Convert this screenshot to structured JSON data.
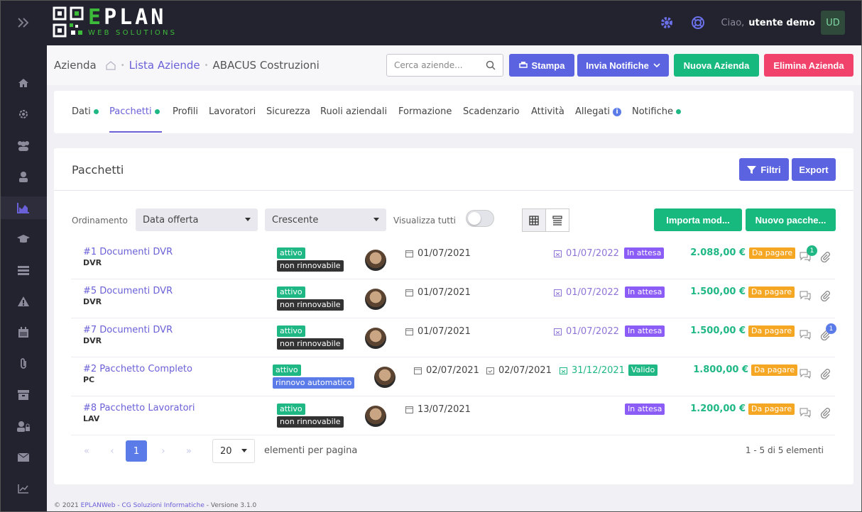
{
  "app": {
    "logo_main": "EPLAN",
    "logo_sub": "WEB SOLUTIONS",
    "greeting": "Ciao,",
    "user": "utente demo",
    "user_initials": "UD"
  },
  "sidebar": {
    "items": [
      "menu-toggle",
      "home",
      "settings",
      "users",
      "worker",
      "chart",
      "education",
      "storage",
      "warning",
      "calendar",
      "attachment",
      "archive",
      "user-lock",
      "mail",
      "reports"
    ]
  },
  "breadcrumb": {
    "section": "Azienda",
    "link": "Lista Aziende",
    "current": "ABACUS Costruzioni"
  },
  "search": {
    "placeholder": "Cerca aziende..."
  },
  "header_buttons": {
    "print": "Stampa",
    "notify": "Invia Notifiche",
    "new": "Nuova Azienda",
    "delete": "Elimina Azienda"
  },
  "tabs": [
    {
      "label": "Dati",
      "dot": true
    },
    {
      "label": "Pacchetti",
      "dot": true,
      "active": true
    },
    {
      "label": "Profili"
    },
    {
      "label": "Lavoratori"
    },
    {
      "label": "Sicurezza"
    },
    {
      "label": "Ruoli aziendali"
    },
    {
      "label": "Formazione"
    },
    {
      "label": "Scadenzario"
    },
    {
      "label": "Attività"
    },
    {
      "label": "Allegati",
      "info": true
    },
    {
      "label": "Notifiche",
      "dot": true
    }
  ],
  "card": {
    "title": "Pacchetti",
    "filter": "Filtri",
    "export": "Export"
  },
  "controls": {
    "order_label": "Ordinamento",
    "order_field": "Data offerta",
    "order_dir": "Crescente",
    "show_all": "Visualizza tutti",
    "import": "Importa mod...",
    "new_package": "Nuovo pacche..."
  },
  "rows": [
    {
      "title": "#1 Documenti DVR",
      "code": "DVR",
      "status": "attivo",
      "renewal": "non rinnovabile",
      "date1": "01/07/2021",
      "date2": "",
      "date3": "01/07/2022",
      "state": "In attesa",
      "price": "2.088,00 €",
      "payment": "Da pagare",
      "chat_count": "1",
      "clip_count": ""
    },
    {
      "title": "#5 Documenti DVR",
      "code": "DVR",
      "status": "attivo",
      "renewal": "non rinnovabile",
      "date1": "01/07/2021",
      "date2": "",
      "date3": "01/07/2022",
      "state": "In attesa",
      "price": "1.500,00 €",
      "payment": "Da pagare",
      "chat_count": "",
      "clip_count": ""
    },
    {
      "title": "#7 Documenti DVR",
      "code": "DVR",
      "status": "attivo",
      "renewal": "non rinnovabile",
      "date1": "01/07/2021",
      "date2": "",
      "date3": "01/07/2022",
      "state": "In attesa",
      "price": "1.500,00 €",
      "payment": "Da pagare",
      "chat_count": "",
      "clip_count": "1"
    },
    {
      "title": "#2 Pacchetto Completo",
      "code": "PC",
      "status": "attivo",
      "renewal": "rinnovo automatico",
      "date1": "02/07/2021",
      "date2": "02/07/2021",
      "date3": "31/12/2021",
      "state": "Valido",
      "price": "1.800,00 €",
      "payment": "Da pagare",
      "chat_count": "",
      "clip_count": ""
    },
    {
      "title": "#8 Pacchetto Lavoratori",
      "code": "LAV",
      "status": "attivo",
      "renewal": "non rinnovabile",
      "date1": "13/07/2021",
      "date2": "",
      "date3": "",
      "state": "In attesa",
      "price": "1.200,00 €",
      "payment": "Da pagare",
      "chat_count": "",
      "clip_count": ""
    }
  ],
  "pagination": {
    "current": "1",
    "page_size": "20",
    "per_page_label": "elementi per pagina",
    "summary": "1 - 5 di 5 elementi",
    "first": "«",
    "prev": "‹",
    "next": "›",
    "last": "»"
  },
  "footer": {
    "year": "© 2021",
    "link": "EPLANWeb - CG Soluzioni Informatiche",
    "version": "- Versione 3.1.0"
  }
}
